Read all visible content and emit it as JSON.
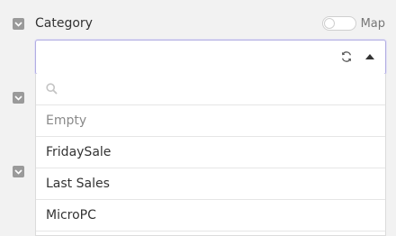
{
  "field": {
    "label": "Category",
    "map_toggle_label": "Map"
  },
  "select": {
    "value": "",
    "refresh_icon": "refresh-icon",
    "caret_icon": "caret-up-icon"
  },
  "dropdown": {
    "search_placeholder": "",
    "options": [
      {
        "label": "Empty"
      },
      {
        "label": "FridaySale"
      },
      {
        "label": "Last Sales"
      },
      {
        "label": "MicroPC"
      }
    ]
  },
  "colors": {
    "accent_border": "#b2aee2",
    "checkbox": "#9a9a9a",
    "background": "#f2f2f2"
  }
}
